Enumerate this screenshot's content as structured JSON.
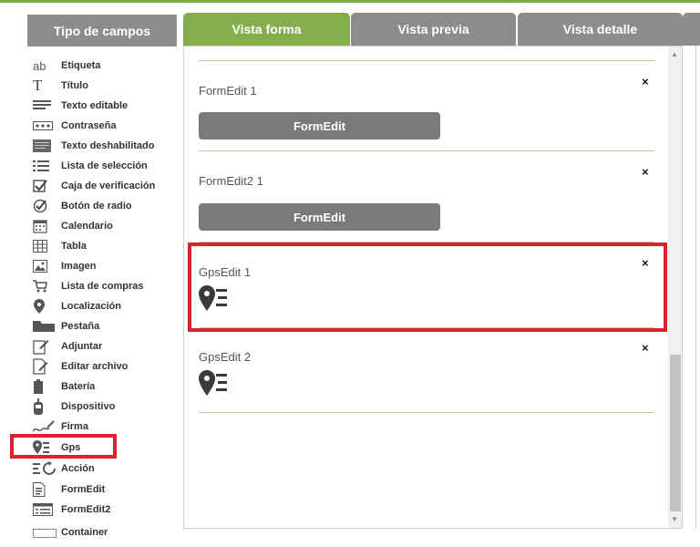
{
  "left_panel": {
    "header": "Tipo de campos",
    "items": [
      {
        "label": "Etiqueta",
        "icon": "text-ab-icon"
      },
      {
        "label": "Título",
        "icon": "text-t-icon"
      },
      {
        "label": "Texto editable",
        "icon": "text-lines-icon"
      },
      {
        "label": "Contraseña",
        "icon": "password-dots-icon"
      },
      {
        "label": "Texto deshabilitado",
        "icon": "text-block-icon"
      },
      {
        "label": "Lista de selección",
        "icon": "list-icon"
      },
      {
        "label": "Caja de verificación",
        "icon": "checkbox-icon"
      },
      {
        "label": "Botón de radio",
        "icon": "radio-check-icon"
      },
      {
        "label": "Calendario",
        "icon": "calendar-icon"
      },
      {
        "label": "Tabla",
        "icon": "table-grid-icon"
      },
      {
        "label": "Imagen",
        "icon": "image-icon"
      },
      {
        "label": "Lista de compras",
        "icon": "cart-icon"
      },
      {
        "label": "Localización",
        "icon": "location-pin-icon"
      },
      {
        "label": "Pestaña",
        "icon": "folder-tab-icon"
      },
      {
        "label": "Adjuntar",
        "icon": "attach-edit-icon"
      },
      {
        "label": "Editar archivo",
        "icon": "edit-file-icon"
      },
      {
        "label": "Batería",
        "icon": "battery-icon"
      },
      {
        "label": "Dispositivo",
        "icon": "device-icon"
      },
      {
        "label": "Firma",
        "icon": "signature-icon"
      },
      {
        "label": "Gps",
        "icon": "gps-pin-list-icon"
      },
      {
        "label": "Acción",
        "icon": "action-refresh-icon"
      },
      {
        "label": "FormEdit",
        "icon": "form-doc-icon"
      },
      {
        "label": "FormEdit2",
        "icon": "form-list-icon"
      },
      {
        "label": "Container",
        "icon": "container-icon"
      }
    ]
  },
  "tabs": [
    {
      "label": "Vista forma",
      "active": true
    },
    {
      "label": "Vista previa",
      "active": false
    },
    {
      "label": "Vista detalle",
      "active": false
    }
  ],
  "main": {
    "rows": [
      {
        "title": "FormEdit 1",
        "button": "FormEdit",
        "close": "×"
      },
      {
        "title": "FormEdit2 1",
        "button": "FormEdit",
        "close": "×"
      },
      {
        "title": "GpsEdit 1",
        "icon": "gps-pin-list-icon",
        "close": "×",
        "highlighted": true
      },
      {
        "title": "GpsEdit 2",
        "icon": "gps-pin-list-icon",
        "close": "×"
      }
    ]
  },
  "colors": {
    "accent_green": "#84ae4d",
    "tab_gray": "#8c8c8c",
    "highlight_red": "#d9232d",
    "button_gray": "#7a7a7a"
  }
}
